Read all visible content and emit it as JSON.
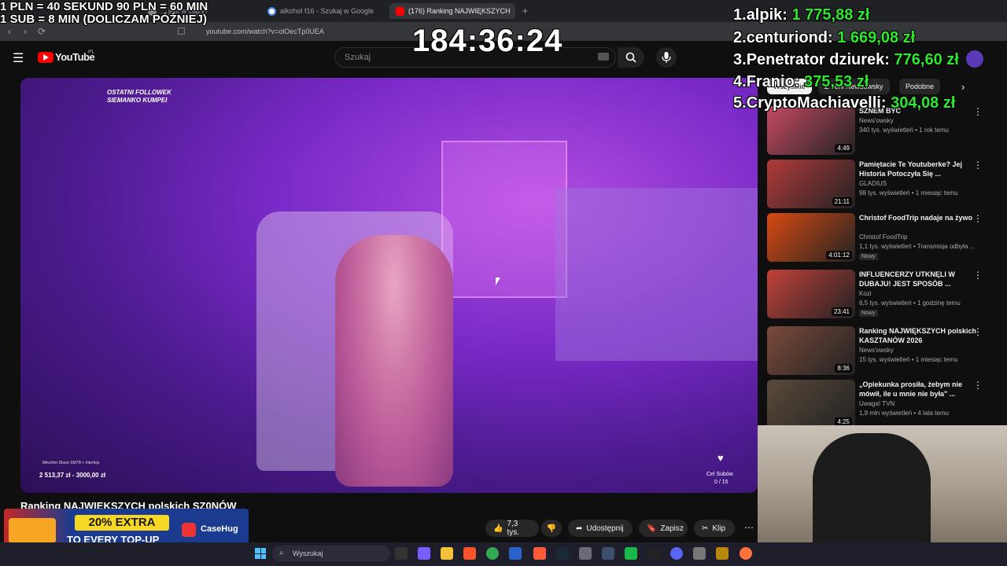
{
  "overlay": {
    "rates_line1": "1 PLN = 40 SEKUND 90 PLN = 60 MIN",
    "rates_line2": "1 SUB = 8 MIN (DOLICZAM PÓŹNIEJ)",
    "timer": "184:36:24",
    "leaderboard": [
      {
        "rank": "1.",
        "name": "alpik:",
        "amount": "1 775,88 zł"
      },
      {
        "rank": "2.",
        "name": "centuriond:",
        "amount": "1 669,08 zł"
      },
      {
        "rank": "3.",
        "name": "Penetrator dziurek:",
        "amount": "776,60 zł"
      },
      {
        "rank": "4.",
        "name": "Franio:",
        "amount": "375,53 zł"
      },
      {
        "rank": "5.",
        "name": "CryptoMachiavelli:",
        "amount": "304,08 zł"
      }
    ],
    "ad_line1": "20% EXTRA",
    "ad_line2": "TO EVERY TOP-UP",
    "ad_brand": "CaseHug"
  },
  "browser": {
    "tabs": [
      {
        "label": "... jest w ciąży?",
        "icon": "page-icon"
      },
      {
        "label": "alkohol f16 - Szukaj w Google",
        "icon": "google-icon"
      },
      {
        "label": "(176) Ranking NAJWIĘKSZYCH",
        "icon": "youtube-icon"
      }
    ],
    "url": "youtube.com/watch?v=olOecTp0UEA"
  },
  "youtube": {
    "logo": "YouTube",
    "logo_region": "PL",
    "search_placeholder": "Szukaj",
    "video_title": "Ranking NAJWIĘKSZYCH polskich SZ0NÓW",
    "video_overlay_top": "OSTATNI FOLLOWEK SIEMANKO KUMPEI",
    "video_overlay_mic": "Mikrofon Shure SM7B + Interfejs",
    "video_overlay_goal": "2 513,37 zł - 3000,00 zł",
    "video_overlay_subs_label": "Cel Subów",
    "video_overlay_subs": "0 / 15",
    "actions": {
      "likes": "7,3 tys.",
      "share": "Udostępnij",
      "save": "Zapisz",
      "clip": "Klip"
    },
    "chips": [
      "Wszystkie",
      "Z serii Newsowsky",
      "Podobne"
    ],
    "recommendations": [
      {
        "title": "SZNEM BYĆ",
        "channel": "News'owsky",
        "meta": "340 tys. wyświetleń • 1 rok temu",
        "duration": "4:49",
        "badge": "",
        "thumb_color": "#c64a63"
      },
      {
        "title": "Pamiętacie Te Youtuberke? Jej Historia Potoczyła Się ...",
        "channel": "GLADIUS",
        "meta": "98 tys. wyświetleń • 1 miesiąc temu",
        "duration": "21:11",
        "badge": "",
        "thumb_color": "#b23a3a"
      },
      {
        "title": "Christof FoodTrip nadaje na żywo",
        "channel": "Christof FoodTrip",
        "meta": "1,1 tys. wyświetleń • Transmisja odbyła ...",
        "duration": "4:01:12",
        "badge": "Nowy",
        "thumb_color": "#d84a12"
      },
      {
        "title": "INFLUENCERZY UTKNĘLI W DUBAJU! JEST SPOSÓB ...",
        "channel": "Kozi",
        "meta": "6,5 tys. wyświetleń • 1 godzinę temu",
        "duration": "23:41",
        "badge": "Nowy",
        "thumb_color": "#c2413a"
      },
      {
        "title": "Ranking NAJWIĘKSZYCH polskich KASZTANÓW 2026",
        "channel": "News'owsky",
        "meta": "15 tys. wyświetleń • 1 miesiąc temu",
        "duration": "8:36",
        "badge": "",
        "thumb_color": "#7a4a3a"
      },
      {
        "title": "„Opiekunka prosiła, żebym nie mówił, ile u mnie nie była\" ...",
        "channel": "Uwaga! TVN",
        "meta": "1,9 mln wyświetleń • 4 lata temu",
        "duration": "4:25",
        "badge": "",
        "thumb_color": "#5a4a3a"
      }
    ]
  },
  "taskbar": {
    "search_placeholder": "Wyszukaj"
  }
}
